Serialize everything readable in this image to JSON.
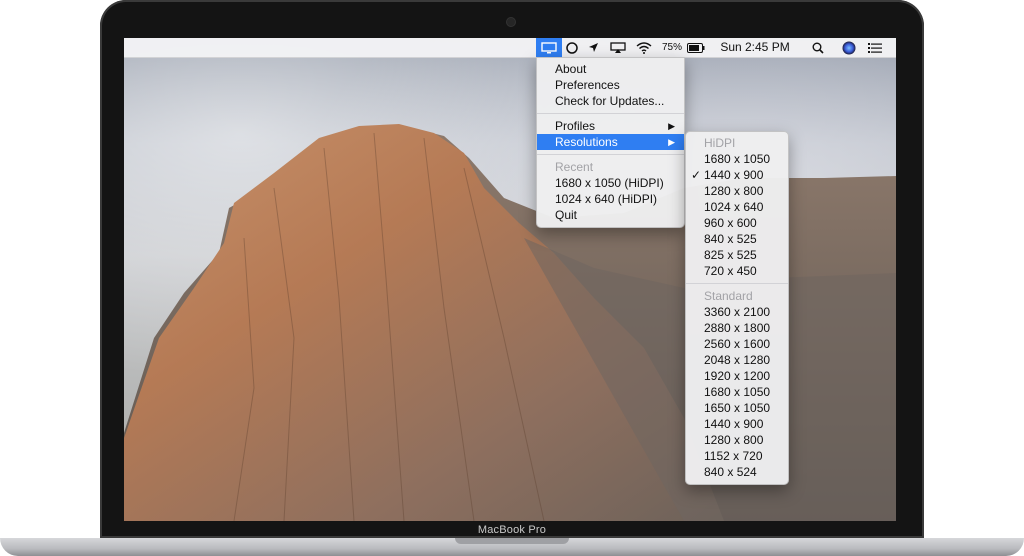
{
  "laptop": {
    "brand_label": "MacBook Pro"
  },
  "menubar": {
    "battery_percent": "75%",
    "clock": "Sun 2:45 PM",
    "icons": [
      "display-icon",
      "circle-icon",
      "location-arrow-icon",
      "airplay-icon",
      "wifi-icon",
      "battery-icon",
      "search-icon",
      "siri-icon",
      "notification-list-icon"
    ]
  },
  "main_menu": {
    "items": {
      "about": "About",
      "preferences": "Preferences",
      "check_updates": "Check for Updates...",
      "profiles": "Profiles",
      "resolutions": "Resolutions",
      "recent_header": "Recent",
      "recent_1": "1680 x 1050 (HiDPI)",
      "recent_2": "1024 x 640 (HiDPI)",
      "quit": "Quit"
    }
  },
  "resolutions_menu": {
    "hidpi_header": "HiDPI",
    "hidpi": [
      "1680 x 1050",
      "1440 x 900",
      "1280 x 800",
      "1024 x 640",
      "960 x 600",
      "840 x 525",
      "825 x 525",
      "720 x 450"
    ],
    "hidpi_selected": "1440 x 900",
    "standard_header": "Standard",
    "standard": [
      "3360 x 2100",
      "2880 x 1800",
      "2560 x 1600",
      "2048 x 1280",
      "1920 x 1200",
      "1680 x 1050",
      "1650 x 1050",
      "1440 x 900",
      "1280 x 800",
      "1152 x 720",
      "840 x 524"
    ]
  },
  "colors": {
    "highlight": "#2f7ef2",
    "menu_bg": "#eeeef0",
    "bezel": "#141414"
  }
}
